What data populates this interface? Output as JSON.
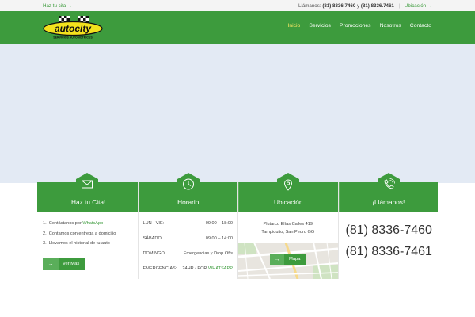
{
  "topbar": {
    "left_link": "Haz tu cita →",
    "call_label": "Llámanos:",
    "phone1": "(81) 8336.7460",
    "conj": "y",
    "phone2": "(81) 8336.7461",
    "location_link": "Ubicación →"
  },
  "nav": {
    "logo_text": "autocity",
    "logo_sub": "SERVICIOS AUTOMOTRICES",
    "items": [
      "Inicio",
      "Servicios",
      "Promociones",
      "Nosotros",
      "Contacto"
    ],
    "active": "Inicio"
  },
  "cards": {
    "cita": {
      "icon": "envelope-icon",
      "title": "¡Haz tu Cita!",
      "items": [
        {
          "num": "1.",
          "text": "Contáctanos por ",
          "link": "WhatsApp"
        },
        {
          "num": "2.",
          "text": "Contamos con entrega a domicilio"
        },
        {
          "num": "3.",
          "text": "Llevamos el historial de tu auto"
        }
      ],
      "button": "Ver Más"
    },
    "horario": {
      "icon": "clock-icon",
      "title": "Horario",
      "rows": [
        {
          "day": "LUN - VIE:",
          "time": "09:00 – 18:00"
        },
        {
          "day": "SÁBADO:",
          "time": "09:00 – 14:00"
        },
        {
          "day": "DOMINGO:",
          "time": "Emergencias y Drop Offs"
        },
        {
          "day": "EMERGENCIAS:",
          "time": "24HR / POR ",
          "link": "WHATSAPP"
        }
      ]
    },
    "ubicacion": {
      "icon": "map-pin-icon",
      "title": "Ubicación",
      "address_line1": "Plutarco Elías Calles 419",
      "address_line2": "Tampiquito, San Pedro GG",
      "button": "Mapa"
    },
    "llamanos": {
      "icon": "phone-call-icon",
      "title": "¡Llámanos!",
      "phone1": "(81) 8336-7460",
      "phone2": "(81) 8336-7461"
    }
  },
  "colors": {
    "brand_green": "#3d9b3d",
    "accent_yellow": "#f5e663",
    "hero_bg": "#e3eaf4"
  }
}
